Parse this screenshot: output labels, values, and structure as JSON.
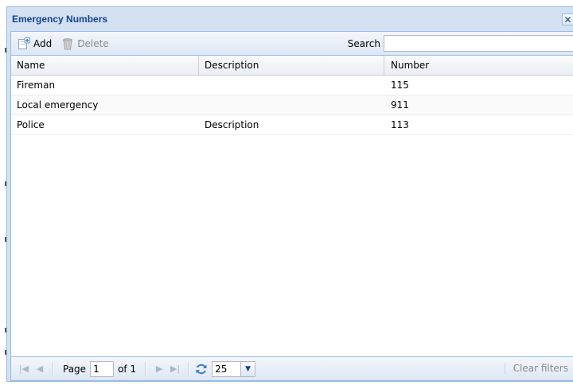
{
  "window": {
    "title": "Emergency Numbers",
    "close_glyph": "✕"
  },
  "toolbar": {
    "add_label": "Add",
    "add_icon": "add-contact-icon",
    "delete_label": "Delete",
    "delete_icon": "trash-icon",
    "search_label": "Search",
    "search_value": ""
  },
  "grid": {
    "columns": [
      "Name",
      "Description",
      "Number"
    ],
    "rows": [
      {
        "name": "Fireman",
        "description": "",
        "number": "115"
      },
      {
        "name": "Local emergency",
        "description": "",
        "number": "911"
      },
      {
        "name": "Police",
        "description": "Description",
        "number": "113"
      }
    ]
  },
  "pager": {
    "page_label": "Page",
    "page_value": "1",
    "of_label": "of 1",
    "page_size": "25",
    "clear_filters_label": "Clear filters"
  },
  "colors": {
    "title": "#15428b",
    "frame": "#d3e1f1",
    "border": "#99bbe8"
  }
}
